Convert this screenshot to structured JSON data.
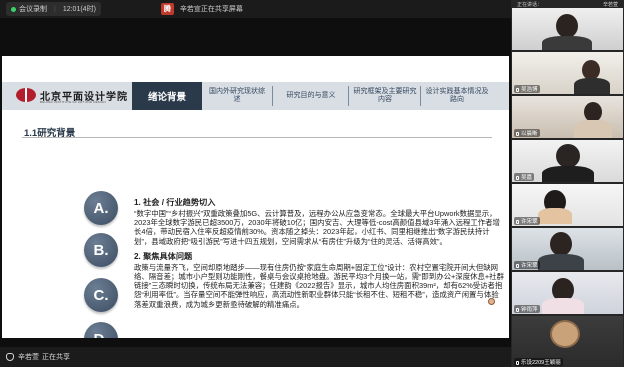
{
  "topbar": {
    "share_status": "会议录制",
    "time_info": "12:01(4时)",
    "app_badge": "腾",
    "meeting_title": "辛若宣正在共享屏幕",
    "controls": [
      "—",
      "□",
      "✕"
    ]
  },
  "slide": {
    "logo_text": "北京平面设计学院",
    "logo_sub": "BEIJING INSTITUTE OF ART AND DESIGN",
    "active_tab": "绪论背景",
    "tabs": [
      "国内外研究现状综述",
      "研究目的与意义",
      "研究框架及主要研究内容",
      "设计实践基本情况及路向"
    ],
    "section_title": "1.1研究背景",
    "bullets": [
      "A.",
      "B.",
      "C.",
      "D."
    ],
    "heading1": "1. 社会 / 行业趋势切入",
    "paragraph1": "“数字中国”“乡村振兴”双重政策叠加5G、云计算普及，远程办公从应急变常态。全球最大平台Upwork数据显示，2023年全球数字游民已超3500万，2030年将破10亿；国内安吉、大理等低-cost高颜值县域3年涌入远程工作者增长4倍，带动民宿入住率反超疫情前30%。资本随之掉头：2023年起，小红书、同里相继推出“数字游民扶持计划”，县域政府把“吸引游民”写进十四五规划，空间需求从“有房住”升级为“住的灵活、活得高效”。",
    "heading2": "2. 聚焦具体问题",
    "paragraph2": "政策与流量齐飞，空间却原地踏步——现有住房仍按“家庭生命周期+固定工位”设计：农村空置宅院开间大但缺网络、隔音差；城市小户型则功能刚性，餐桌与会议桌抢地盘。游民平均3个月换一站，需“即到办公+深度休息+社群链接”三态瞬时切换，传统布局无法兼容；任建韵《2022报告》显示，城市人均住房面积39m²，却有62%受访者抱怨“利用率低”。当存量空间不能弹性响应，高流动性新职业群体只能“长租不住、短租不稳”，造成资产闲置与体验落差双重浪费，成为城乡更新亟待破解的精准痛点。",
    "page_number": "6"
  },
  "bottombar": {
    "presenter_name": "辛若萱",
    "presenter_status": "正在共享"
  },
  "sidebar": {
    "header_left": "正在讲话：",
    "header_right": "辛若萱",
    "participants": [
      {
        "name": ""
      },
      {
        "name": "吴浩博"
      },
      {
        "name": "以晨晰"
      },
      {
        "name": "吴嘉"
      },
      {
        "name": "许宋翠"
      },
      {
        "name": "许宋翠"
      },
      {
        "name": "钟雨萍"
      },
      {
        "name": "乐设2209王颖丽"
      }
    ]
  }
}
